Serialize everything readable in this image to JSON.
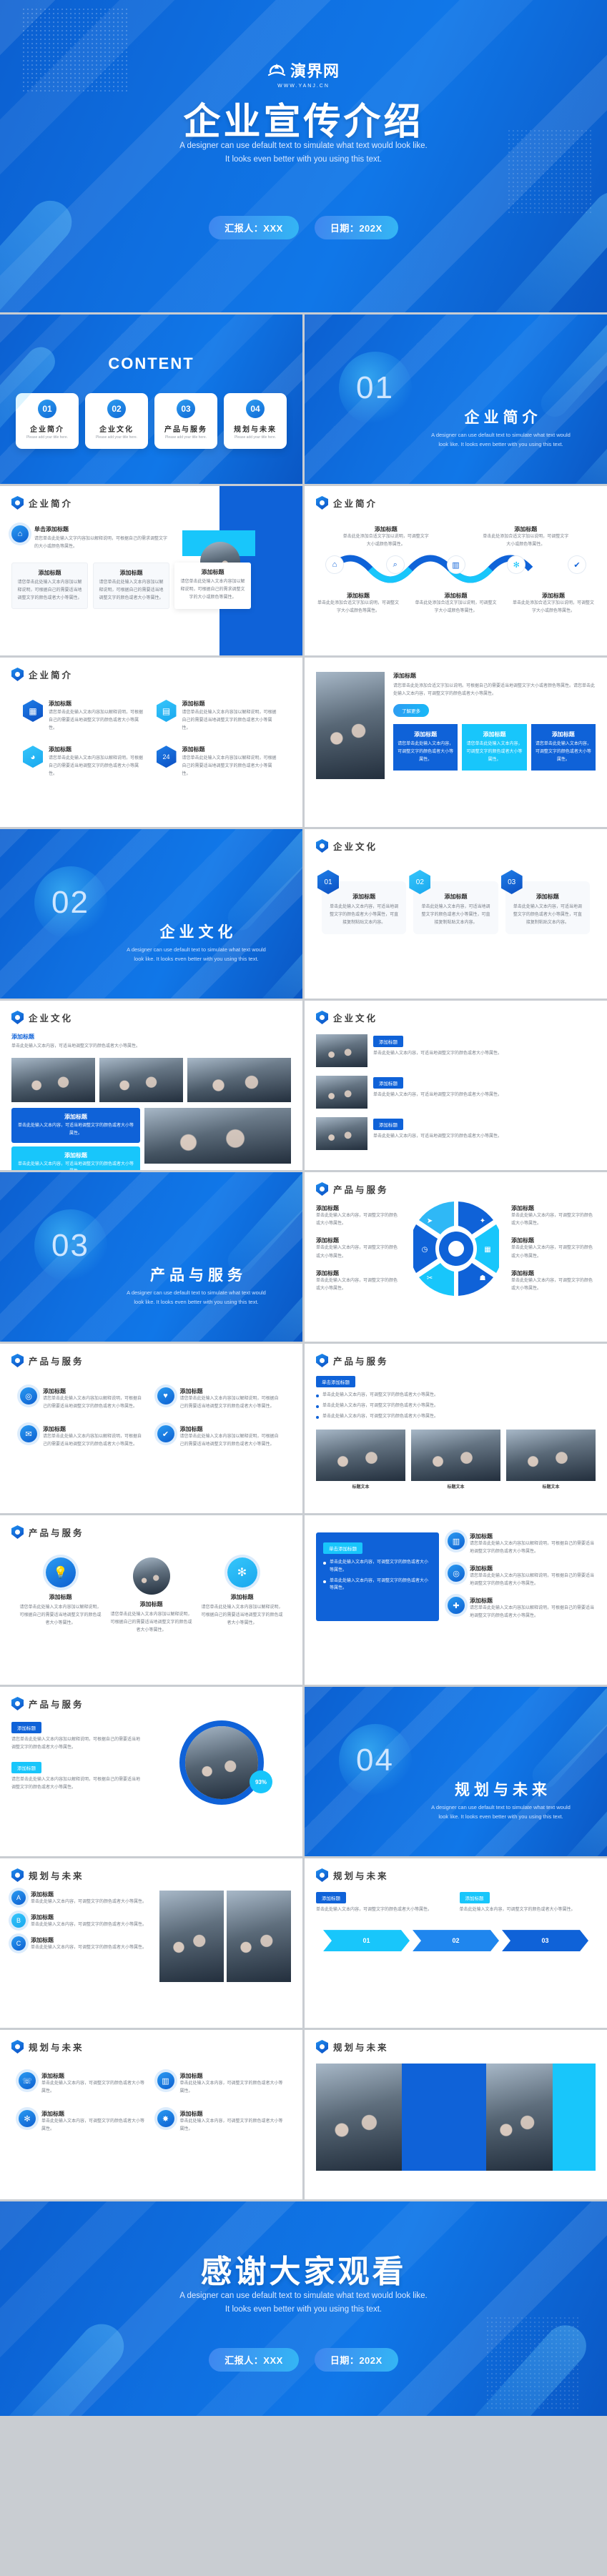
{
  "brand": {
    "logo_text": "演界网",
    "logo_url": "WWW.YANJ.CN",
    "accent_blue": "#0f62d8",
    "accent_cyan": "#18c6fb",
    "deep_blue": "#0b4ec2"
  },
  "cover": {
    "title": "企业宣传介绍",
    "subtitle_line1": "A designer can use default text to simulate what text would look like.",
    "subtitle_line2": "It looks even better with you using this text.",
    "pill_presenter": "汇报人：XXX",
    "pill_date": "日期：202X"
  },
  "content_slide": {
    "heading": "CONTENT",
    "items": [
      {
        "num": "01",
        "title": "企业简介",
        "sub": "Please add your title here."
      },
      {
        "num": "02",
        "title": "企业文化",
        "sub": "Please add your title here."
      },
      {
        "num": "03",
        "title": "产品与服务",
        "sub": "Please add your title here."
      },
      {
        "num": "04",
        "title": "规划与未来",
        "sub": "Please add your title here."
      }
    ]
  },
  "sections": [
    {
      "num": "01",
      "title": "企业简介",
      "sub_l1": "A designer can use default text to simulate what text would",
      "sub_l2": "look like. It looks even better with you using this text."
    },
    {
      "num": "02",
      "title": "企业文化",
      "sub_l1": "A designer can use default text to simulate what text would",
      "sub_l2": "look like. It looks even better with you using this text."
    },
    {
      "num": "03",
      "title": "产品与服务",
      "sub_l1": "A designer can use default text to simulate what text would",
      "sub_l2": "look like. It looks even better with you using this text."
    },
    {
      "num": "04",
      "title": "规划与未来",
      "sub_l1": "A designer can use default text to simulate what text would",
      "sub_l2": "look like. It looks even better with you using this text."
    }
  ],
  "headers": {
    "intro": "企业简介",
    "culture": "企业文化",
    "product": "产品与服务",
    "future": "规划与未来"
  },
  "common": {
    "add_title": "添加标题",
    "click_add_title": "单击添加标题",
    "body_a": "请您单击此处输入文字内容加以解释说明，可根据自己的需求调整文字的大小或颜色等属性。",
    "body_b": "请您单击此处输入文本内容加以解释说明，可根据自己的需要适当地调整文字的颜色或者大小等属性。",
    "body_c": "单击此处添加合适文字加以说明，可调整文字大小或颜色等属性。",
    "body_d": "单击此处输入文本内容，可适当地调整文字的颜色或者大小等属性，可直接复制粘贴文本内容。",
    "body_e": "请您单击此处输入文本内容，可调整文字的颜色或者大小等属性。",
    "body_f": "单击此处输入文本内容，可调整文字的颜色或大小等属性。",
    "long_body": "请您单击此处添加合适文字加以说明。可根据自己的需要适当地调整文字大小或者颜色等属性。请您单击此处输入文本内容，可调整文字的颜色或者大小等属性。",
    "more_button": "了解更多",
    "percent": "93%"
  },
  "slide_intro_1": {
    "header": "企业简介",
    "lead_title": "单击添加标题",
    "lead_body": "请您单击此处输入文字内容加以解释说明，可根据自己的需求调整文字的大小或颜色等属性。",
    "cards": [
      {
        "title": "添加标题",
        "body": "请您单击此处输入文本内容加以解释说明，可根据自己的需要适当地调整文字的颜色或者大小等属性。"
      },
      {
        "title": "添加标题",
        "body": "请您单击此处输入文本内容加以解释说明，可根据自己的需要适当地调整文字的颜色或者大小等属性。"
      },
      {
        "title": "添加标题",
        "body": "请您单击此处输入文本内容加以解释说明，可根据自己的需求调整文字的大小或颜色等属性。"
      }
    ]
  },
  "slide_intro_2": {
    "header": "企业简介",
    "top": [
      {
        "title": "添加标题",
        "body": "单击此处添加合适文字加以说明，可调整文字大小或颜色等属性。"
      },
      {
        "title": "添加标题",
        "body": "单击此处添加合适文字加以说明，可调整文字大小或颜色等属性。"
      }
    ],
    "bottom": [
      {
        "title": "添加标题",
        "body": "单击此处添加合适文字加以说明，可调整文字大小或颜色等属性。"
      },
      {
        "title": "添加标题",
        "body": "单击此处添加合适文字加以说明，可调整文字大小或颜色等属性。"
      },
      {
        "title": "添加标题",
        "body": "单击此处添加合适文字加以说明，可调整文字大小或颜色等属性。"
      }
    ],
    "icons": [
      "home-icon",
      "search-icon",
      "chart-icon",
      "gear-icon",
      "check-icon"
    ]
  },
  "slide_intro_3": {
    "header": "企业简介",
    "items": [
      {
        "icon": "building-icon",
        "title": "添加标题",
        "body": "请您单击此处输入文本内容加以解释说明，可根据自己的需要适当地调整文字的颜色或者大小等属性。"
      },
      {
        "icon": "presentation-icon",
        "title": "添加标题",
        "body": "请您单击此处输入文本内容加以解释说明，可根据自己的需要适当地调整文字的颜色或者大小等属性。"
      },
      {
        "icon": "meter-icon",
        "title": "添加标题",
        "body": "请您单击此处输入文本内容加以解释说明，可根据自己的需要适当地调整文字的颜色或者大小等属性。"
      },
      {
        "icon": "24h-icon",
        "title": "添加标题",
        "body": "请您单击此处输入文本内容加以解释说明，可根据自己的需要适当地调整文字的颜色或者大小等属性。"
      }
    ]
  },
  "slide_intro_4": {
    "header": "企业简介",
    "title": "添加标题",
    "body": "请您单击此处添加合适文字加以说明。可根据自己的需要适当地调整文字大小或者颜色等属性。请您单击此处输入文本内容，可调整文字的颜色或者大小等属性。",
    "button": "了解更多",
    "boxes": [
      {
        "title": "添加标题",
        "body": "请您单击此处输入文本内容，可调整文字的颜色或者大小等属性。"
      },
      {
        "title": "添加标题",
        "body": "请您单击此处输入文本内容，可调整文字的颜色或者大小等属性。"
      },
      {
        "title": "添加标题",
        "body": "请您单击此处输入文本内容，可调整文字的颜色或者大小等属性。"
      }
    ]
  },
  "slide_culture_1": {
    "header": "企业文化",
    "items": [
      {
        "num": "01",
        "title": "添加标题",
        "body": "单击此处输入文本内容，可适当地调整文字的颜色或者大小等属性，可直接复制粘贴文本内容。"
      },
      {
        "num": "02",
        "title": "添加标题",
        "body": "单击此处输入文本内容，可适当地调整文字的颜色或者大小等属性，可直接复制粘贴文本内容。"
      },
      {
        "num": "03",
        "title": "添加标题",
        "body": "单击此处输入文本内容，可适当地调整文字的颜色或者大小等属性，可直接复制粘贴文本内容。"
      }
    ]
  },
  "slide_culture_2": {
    "header": "企业文化",
    "title": "添加标题",
    "body": "单击此处输入文本内容，可适当地调整文字的颜色或者大小等属性。",
    "tags": [
      "添加标题",
      "添加标题"
    ]
  },
  "slide_culture_3": {
    "header": "企业文化",
    "items": [
      {
        "title": "添加标题",
        "body": "单击此处输入文本内容，可适当地调整文字的颜色或者大小等属性。"
      },
      {
        "title": "添加标题",
        "body": "单击此处输入文本内容，可适当地调整文字的颜色或者大小等属性。"
      },
      {
        "title": "添加标题",
        "body": "单击此处输入文本内容，可适当地调整文字的颜色或者大小等属性。"
      }
    ]
  },
  "slide_product_1": {
    "header": "产品与服务",
    "left": [
      {
        "title": "添加标题",
        "body": "单击此处输入文本内容，可调整文字的颜色或大小等属性。"
      },
      {
        "title": "添加标题",
        "body": "单击此处输入文本内容，可调整文字的颜色或大小等属性。"
      },
      {
        "title": "添加标题",
        "body": "单击此处输入文本内容，可调整文字的颜色或大小等属性。"
      }
    ],
    "right": [
      {
        "title": "添加标题",
        "body": "单击此处输入文本内容，可调整文字的颜色或大小等属性。"
      },
      {
        "title": "添加标题",
        "body": "单击此处输入文本内容，可调整文字的颜色或大小等属性。"
      },
      {
        "title": "添加标题",
        "body": "单击此处输入文本内容，可调整文字的颜色或大小等属性。"
      }
    ],
    "wheel_icons": [
      "rocket-icon",
      "pin-icon",
      "clock-icon",
      "calendar-icon",
      "tools-icon",
      "bulb-icon"
    ]
  },
  "slide_product_2": {
    "header": "产品与服务",
    "items": [
      {
        "title": "添加标题",
        "body": "请您单击此处输入文本内容加以解释说明，可根据自己的需要适当地调整文字的颜色或者大小等属性。"
      },
      {
        "title": "添加标题",
        "body": "请您单击此处输入文本内容加以解释说明，可根据自己的需要适当地调整文字的颜色或者大小等属性。"
      },
      {
        "title": "添加标题",
        "body": "请您单击此处输入文本内容加以解释说明，可根据自己的需要适当地调整文字的颜色或者大小等属性。"
      },
      {
        "title": "添加标题",
        "body": "请您单击此处输入文本内容加以解释说明，可根据自己的需要适当地调整文字的颜色或者大小等属性。"
      }
    ]
  },
  "slide_product_3": {
    "header": "产品与服务",
    "title": "单击添加标题",
    "bullets": [
      "单击此处输入文本内容，可调整文字的颜色或者大小等属性。",
      "单击此处输入文本内容，可调整文字的颜色或者大小等属性。",
      "单击此处输入文本内容，可调整文字的颜色或者大小等属性。"
    ],
    "captions": [
      "标题文本",
      "标题文本",
      "标题文本"
    ]
  },
  "slide_product_4": {
    "header": "产品与服务",
    "items": [
      {
        "title": "添加标题",
        "body": "请您单击此处输入文本内容加以解释说明，可根据自己的需要适当地调整文字的颜色或者大小等属性。"
      },
      {
        "title": "添加标题",
        "body": "请您单击此处输入文本内容加以解释说明，可根据自己的需要适当地调整文字的颜色或者大小等属性。"
      },
      {
        "title": "添加标题",
        "body": "请您单击此处输入文本内容加以解释说明，可根据自己的需要适当地调整文字的颜色或者大小等属性。"
      }
    ]
  },
  "slide_product_5": {
    "header": "产品与服务",
    "title": "单击添加标题",
    "bullets": [
      "单击此处输入文本内容，可调整文字的颜色或者大小等属性。",
      "单击此处输入文本内容，可调整文字的颜色或者大小等属性。"
    ],
    "items": [
      {
        "title": "添加标题",
        "body": "请您单击此处输入文本内容加以解释说明，可根据自己的需要适当地调整文字的颜色或者大小等属性。"
      },
      {
        "title": "添加标题",
        "body": "请您单击此处输入文本内容加以解释说明，可根据自己的需要适当地调整文字的颜色或者大小等属性。"
      },
      {
        "title": "添加标题",
        "body": "请您单击此处输入文本内容加以解释说明，可根据自己的需要适当地调整文字的颜色或者大小等属性。"
      }
    ]
  },
  "slide_product_6": {
    "header": "产品与服务",
    "items": [
      {
        "title": "添加标题",
        "body": "请您单击此处输入文本内容加以解释说明，可根据自己的需要适当地调整文字的颜色或者大小等属性。"
      },
      {
        "title": "添加标题",
        "body": "请您单击此处输入文本内容加以解释说明，可根据自己的需要适当地调整文字的颜色或者大小等属性。"
      }
    ],
    "ring_value": "93%"
  },
  "slide_future_1": {
    "header": "规划与未来",
    "items": [
      {
        "letter": "A",
        "title": "添加标题",
        "body": "单击此处输入文本内容，可调整文字的颜色或者大小等属性。"
      },
      {
        "letter": "B",
        "title": "添加标题",
        "body": "单击此处输入文本内容，可调整文字的颜色或者大小等属性。"
      },
      {
        "letter": "C",
        "title": "添加标题",
        "body": "单击此处输入文本内容，可调整文字的颜色或者大小等属性。"
      }
    ]
  },
  "slide_future_2": {
    "header": "规划与未来",
    "cards": [
      {
        "title": "添加标题",
        "body": "单击此处输入文本内容，可调整文字的颜色或者大小等属性。"
      },
      {
        "title": "添加标题",
        "body": "单击此处输入文本内容，可调整文字的颜色或者大小等属性。"
      }
    ],
    "steps": [
      "01",
      "02",
      "03"
    ]
  },
  "slide_future_3": {
    "header": "规划与未来",
    "items": [
      {
        "title": "添加标题",
        "body": "单击此处输入文本内容，可调整文字的颜色或者大小等属性。"
      },
      {
        "title": "添加标题",
        "body": "单击此处输入文本内容，可调整文字的颜色或者大小等属性。"
      },
      {
        "title": "添加标题",
        "body": "单击此处输入文本内容，可调整文字的颜色或者大小等属性。"
      },
      {
        "title": "添加标题",
        "body": "单击此处输入文本内容，可调整文字的颜色或者大小等属性。"
      }
    ]
  },
  "slide_future_4": {
    "header": "规划与未来"
  },
  "ending": {
    "title": "感谢大家观看",
    "subtitle_line1": "A designer can use default text to simulate what text would look like.",
    "subtitle_line2": "It looks even better with you using this text.",
    "pill_presenter": "汇报人：XXX",
    "pill_date": "日期：202X"
  }
}
